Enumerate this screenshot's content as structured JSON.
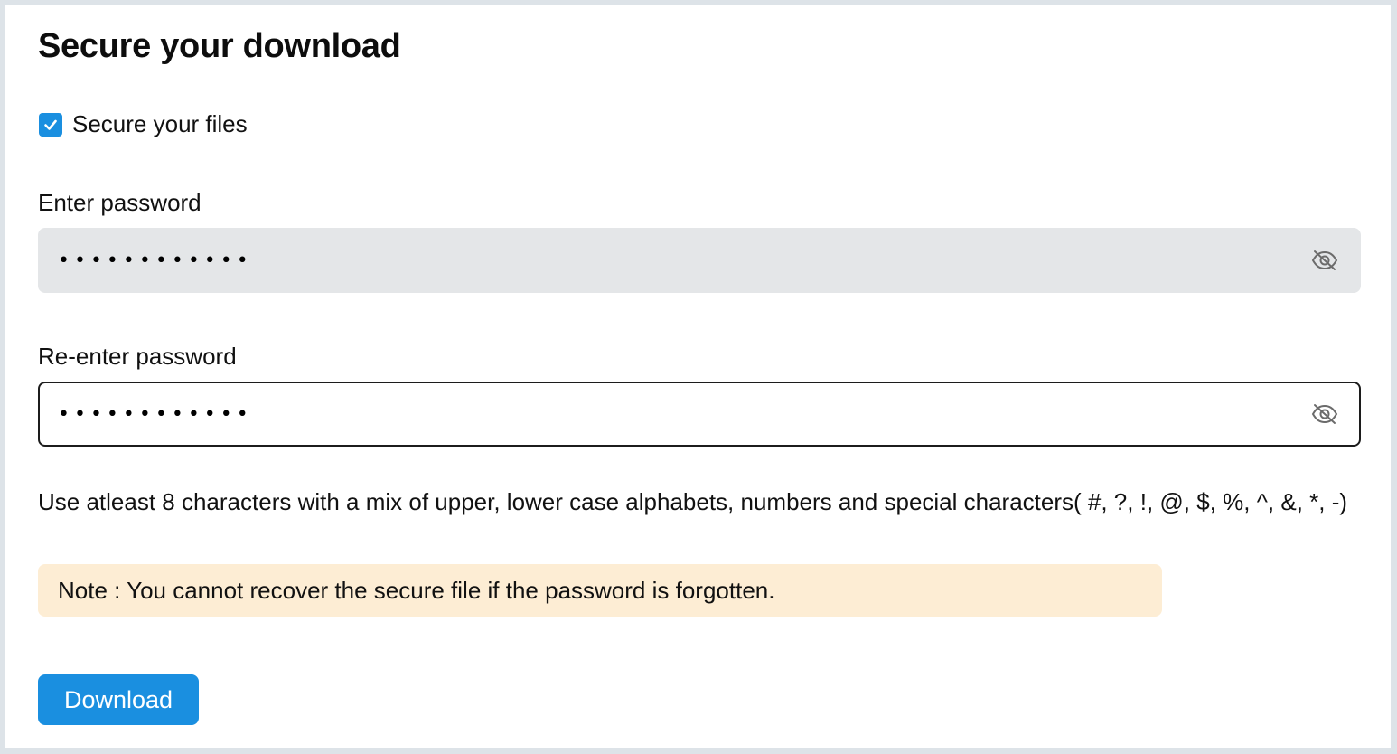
{
  "dialog": {
    "title": "Secure your download"
  },
  "secure_files": {
    "label": "Secure your files",
    "checked": true
  },
  "password": {
    "label": "Enter password",
    "masked_value": "••••••••••••",
    "toggle_icon": "eye-slash-icon"
  },
  "confirm_password": {
    "label": "Re-enter password",
    "masked_value": "••••••••••••",
    "toggle_icon": "eye-slash-icon"
  },
  "hint": "Use atleast 8 characters with a mix of upper, lower case alphabets, numbers and special characters( #, ?, !, @, $, %, ^, &, *, -)",
  "note": "Note : You cannot recover the secure file if the password is forgotten.",
  "actions": {
    "download_label": "Download"
  },
  "colors": {
    "accent": "#1a8fe0",
    "field_filled_bg": "#e4e6e8",
    "note_bg": "#fdedd4",
    "outer_bg": "#dde3e8"
  }
}
